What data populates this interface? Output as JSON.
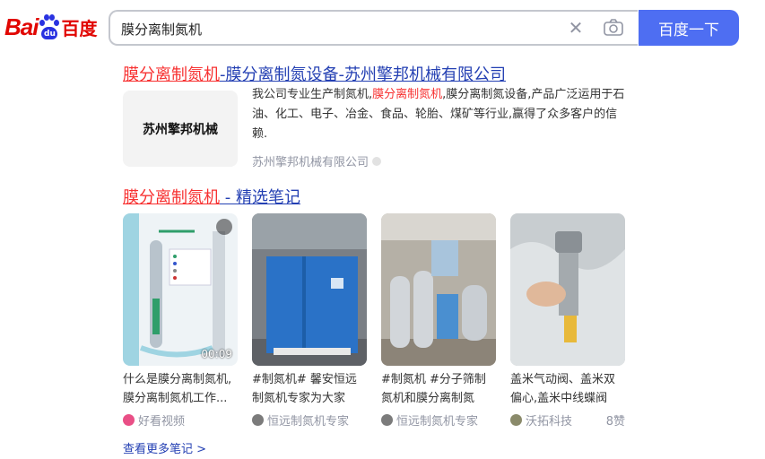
{
  "header": {
    "logo_text_left": "Bai",
    "logo_paw_text": "du",
    "logo_text_right": "百度",
    "search_value": "膜分离制氮机",
    "search_button": "百度一下",
    "clear_icon": "close-icon",
    "camera_icon": "camera-icon"
  },
  "result1": {
    "title_em1": "膜分离制氮机",
    "title_rest": "-膜分离制氮设备-苏州擎邦机械有限公司",
    "thumb_text": "苏州擎邦机械",
    "abstract_pre": "我公司专业生产制氮机,",
    "abstract_em": "膜分离制氮机",
    "abstract_post": ",膜分离制氮设备,产品广泛运用于石油、化工、电子、冶金、食品、轮胎、煤矿等行业,赢得了众多客户的信赖.",
    "source": "苏州擎邦机械有限公司"
  },
  "result2": {
    "title_em": "膜分离制氮机",
    "title_rest": " - 精选笔记",
    "cards": [
      {
        "caption": "什么是膜分离制氮机,膜分离制氮机工作...",
        "author": "好看视频",
        "duration": "00:09",
        "likes": ""
      },
      {
        "caption": "#制氮机# 馨安恒远制氮机专家为大家介...",
        "author": "恒远制氮机专家",
        "duration": "",
        "likes": ""
      },
      {
        "caption": "#制氮机 #分子筛制氮机和膜分离制氮机...",
        "author": "恒远制氮机专家",
        "duration": "",
        "likes": ""
      },
      {
        "caption": "盖米气动阀、盖米双偏心,盖米中线蝶阀",
        "author": "沃拓科技",
        "duration": "",
        "likes": "8赞"
      }
    ],
    "more_link": "查看更多笔记 >"
  },
  "colors": {
    "accent": "#4e6ef2",
    "link": "#2440b3",
    "highlight": "#f73131"
  }
}
